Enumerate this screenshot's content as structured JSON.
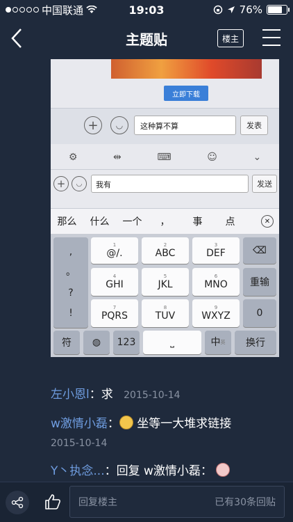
{
  "status_bar": {
    "carrier": "中国联通",
    "time": "19:03",
    "battery": "76%",
    "battery_level": 0.76
  },
  "nav": {
    "title": "主题贴",
    "owner_label": "楼主"
  },
  "embedded": {
    "download_label": "立即下载",
    "input1_value": "这种算不算",
    "send1_label": "发表",
    "input2_value": "我有",
    "send2_label": "发送",
    "candidates": [
      "那么",
      "什么",
      "一个",
      "，",
      "事",
      "点"
    ],
    "keys": {
      "col1": [
        ",",
        "。",
        "?",
        "!"
      ],
      "row1": [
        {
          "num": "1",
          "label": "@/."
        },
        {
          "num": "2",
          "label": "ABC"
        },
        {
          "num": "3",
          "label": "DEF"
        }
      ],
      "row2": [
        {
          "num": "4",
          "label": "GHI"
        },
        {
          "num": "5",
          "label": "JKL"
        },
        {
          "num": "6",
          "label": "MNO"
        }
      ],
      "row3": [
        {
          "num": "7",
          "label": "PQRS"
        },
        {
          "num": "8",
          "label": "TUV"
        },
        {
          "num": "9",
          "label": "WXYZ"
        }
      ],
      "reenter": "重输",
      "zero": "0",
      "fu": "符",
      "num123": "123",
      "zh": "中",
      "zh_sub": "英",
      "newline": "换行"
    }
  },
  "comments": [
    {
      "user": "左小恩l",
      "text": "求",
      "date": "2015-10-14"
    },
    {
      "user": "w激情小磊",
      "text": "坐等一大堆求链接",
      "date": "2015-10-14"
    },
    {
      "user": "Y丶执念...",
      "text": "回复 w激情小磊："
    }
  ],
  "bottom": {
    "reply_placeholder": "回复楼主",
    "reply_count": "已有30条回贴"
  }
}
